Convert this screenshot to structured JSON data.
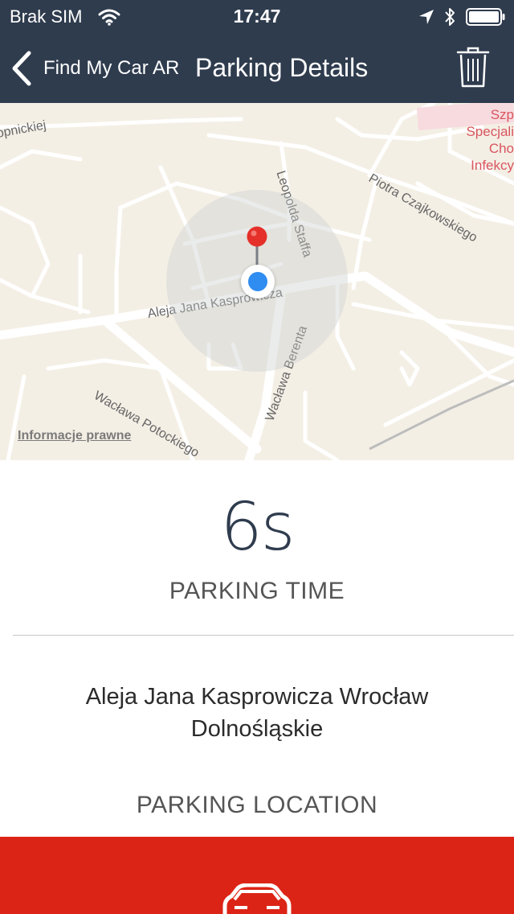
{
  "status": {
    "carrier": "Brak SIM",
    "time": "17:47"
  },
  "nav": {
    "back_label": "Find My Car AR",
    "title": "Parking Details"
  },
  "map": {
    "labels": {
      "street_1": "opnickiej",
      "street_2": "Leopolda Staffa",
      "street_3": "Piotra Czajkowskiego",
      "street_4": "Aleja Jana Kasprowicza",
      "street_5": "Wacława Berenta",
      "street_6": "Wacława Potockiego",
      "poi_lines": [
        "Szp",
        "Specjali",
        "Cho",
        "Infekcy"
      ]
    },
    "legal": "Informacje prawne"
  },
  "parking": {
    "duration": "6s",
    "duration_caption": "PARKING TIME",
    "address_line1": "Aleja Jana Kasprowicza Wrocław",
    "address_line2": "Dolnośląskie",
    "location_caption": "PARKING LOCATION"
  },
  "colors": {
    "nav_bg": "#2f3c4e",
    "accent_red": "#dc2416",
    "user_location": "#2f8cf0",
    "map_bg": "#f4efe5"
  },
  "icons": [
    "wifi-icon",
    "location-arrow-icon",
    "bluetooth-icon",
    "battery-icon",
    "back-chevron-icon",
    "trash-icon",
    "map-pin-icon",
    "car-icon"
  ]
}
